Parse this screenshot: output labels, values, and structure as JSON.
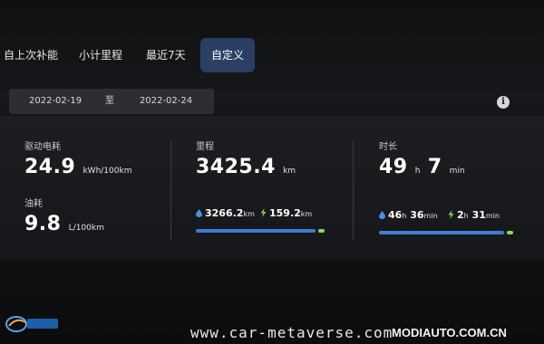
{
  "tabs": [
    {
      "label": "自上次补能",
      "active": false
    },
    {
      "label": "小计里程",
      "active": false
    },
    {
      "label": "最近7天",
      "active": false
    },
    {
      "label": "自定义",
      "active": true
    }
  ],
  "date_range": {
    "start": "2022-02-19",
    "separator": "至",
    "end": "2022-02-24"
  },
  "info_icon": "i",
  "energy": {
    "label": "驱动电耗",
    "value": "24.9",
    "unit": "kWh/100km"
  },
  "fuel": {
    "label": "油耗",
    "value": "9.8",
    "unit": "L/100km"
  },
  "mileage": {
    "label": "里程",
    "value": "3425.4",
    "unit": "km",
    "fuel_value": "3266.2",
    "fuel_unit": "km",
    "electric_value": "159.2",
    "electric_unit": "km",
    "fuel_share": 0.953,
    "electric_share": 0.047
  },
  "duration": {
    "label": "时长",
    "hours": "49",
    "hours_unit": "h",
    "minutes": "7",
    "minutes_unit": "min",
    "fuel_hours": "46",
    "fuel_hours_unit": "h",
    "fuel_minutes": "36",
    "fuel_minutes_unit": "min",
    "electric_hours": "2",
    "electric_hours_unit": "h",
    "electric_minutes": "31",
    "electric_minutes_unit": "min",
    "fuel_share": 0.949,
    "electric_share": 0.051
  },
  "watermarks": {
    "url": "www.car-metaverse.com",
    "site": "MODIAUTO.COM.CN",
    "logo_text": "摩登汽车"
  },
  "colors": {
    "accent_tab": "#2b3f64",
    "fuel_bar": "#3d7fd0",
    "electric_bar": "#8ad85a",
    "drop_icon": "#4a90e2",
    "bolt_icon": "#7fd24a"
  },
  "icons": {
    "fuel": "water-drop-icon",
    "electric": "lightning-bolt-icon",
    "info": "info-icon"
  }
}
